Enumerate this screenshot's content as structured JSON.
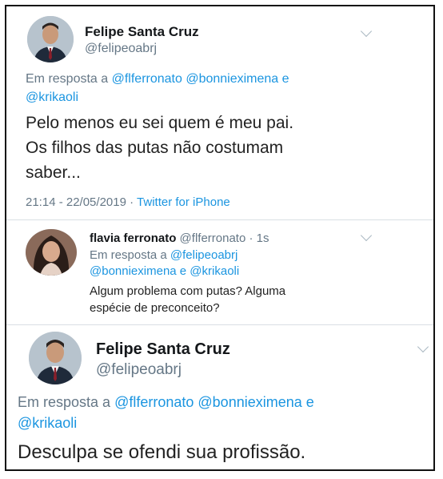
{
  "tweet1": {
    "display_name": "Felipe Santa Cruz",
    "handle": "@felipeoabrj",
    "reply_prefix": "Em resposta a",
    "reply_mentions_line1": "@flferronato @bonnieximena e",
    "reply_mentions_line2": "@krikaoli",
    "text_line1": "Pelo menos eu sei quem é meu pai.",
    "text_line2": "Os filhos das putas não costumam",
    "text_line3": "saber...",
    "timestamp": "21:14 - 22/05/2019",
    "separator": "·",
    "source": "Twitter for iPhone"
  },
  "tweet2": {
    "display_name": "flavia ferronato",
    "handle": "@flferronato",
    "age": "· 1s",
    "reply_prefix": "Em resposta a",
    "reply_mention1": "@felipeoabrj",
    "reply_mentions_line2": "@bonnieximena e @krikaoli",
    "text_line1": "Algum problema com putas? Alguma",
    "text_line2": "espécie de preconceito?"
  },
  "tweet3": {
    "display_name": "Felipe Santa Cruz",
    "handle": "@felipeoabrj",
    "reply_prefix": "Em resposta a",
    "reply_mentions_line1": "@flferronato @bonnieximena e",
    "reply_mentions_line2": "@krikaoli",
    "text_line1": "Desculpa se ofendi sua profissão."
  },
  "colors": {
    "link": "#1b95e0",
    "muted": "#657786",
    "text": "#14171a"
  },
  "icons": [
    "chevron-down-icon",
    "avatar"
  ]
}
